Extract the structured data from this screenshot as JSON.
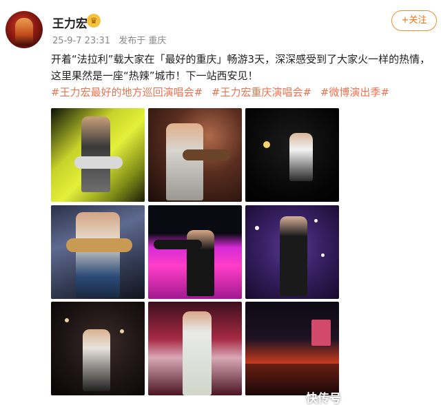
{
  "user": {
    "name": "王力宏",
    "badge_icon": "vip-crown-icon"
  },
  "meta": {
    "timestamp": "25-9-7 23:31",
    "source": "发布于 重庆"
  },
  "follow": {
    "label": "+关注"
  },
  "post": {
    "text": "开着“法拉利”载大家在「最好的重庆」畅游3天，深深感受到了大家火一样的热情，这里果然是一座“热辣”城市！下一站西安见！",
    "hashtags": [
      "#王力宏最好的地方巡回演唱会#",
      "#王力宏重庆演唱会#",
      "#微博演出季#"
    ]
  },
  "colors": {
    "accent": "#eb7350",
    "follow_border": "#f08a2d"
  },
  "watermark": "快传号"
}
